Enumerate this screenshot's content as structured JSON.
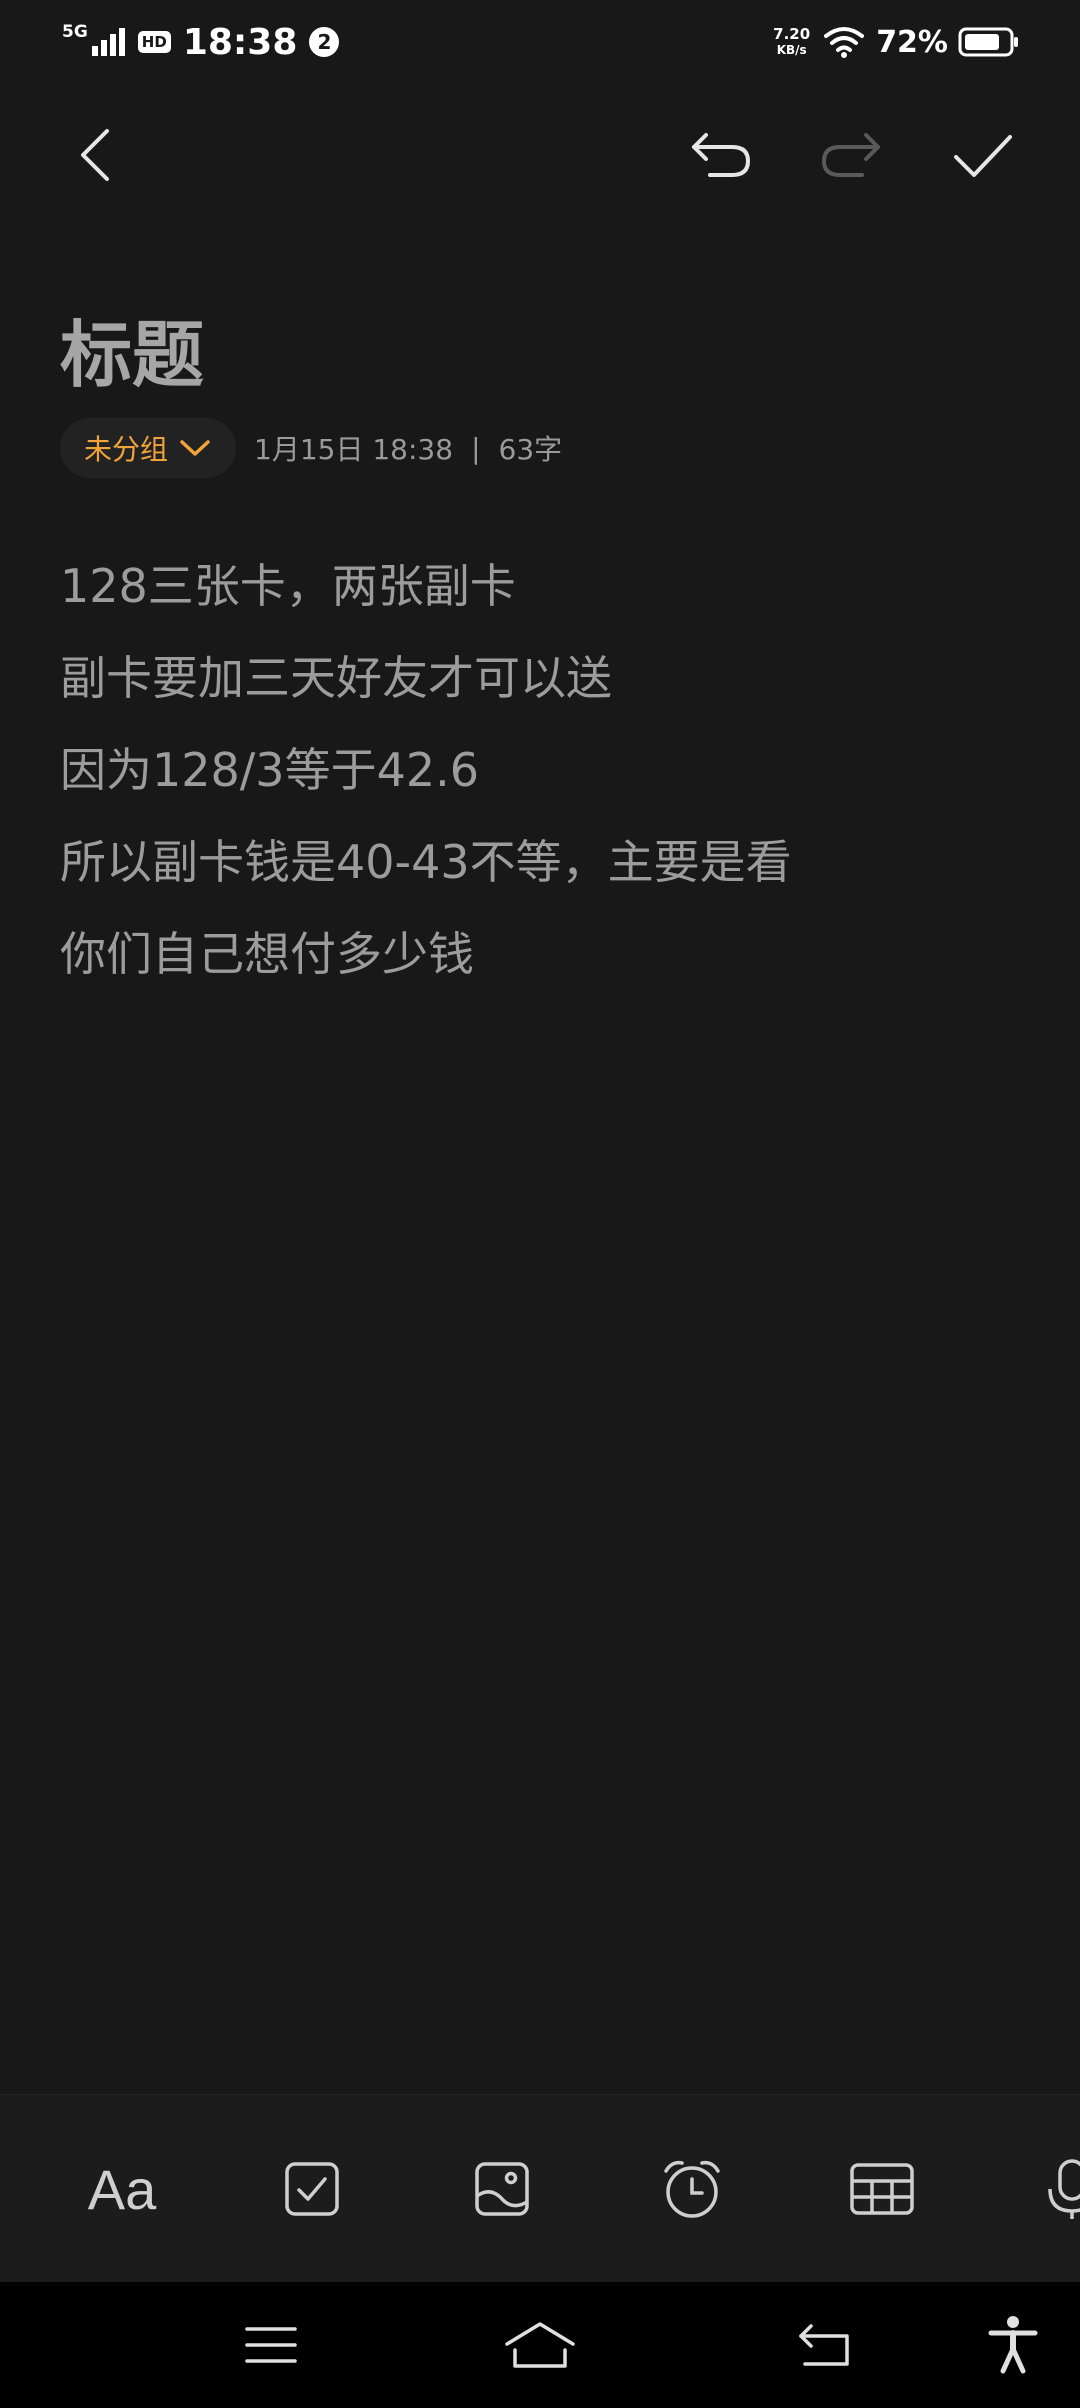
{
  "status_bar": {
    "network": "5G",
    "hd": "HD",
    "time": "18:38",
    "notification_count": "2",
    "speed_value": "7.20",
    "speed_unit": "KB/s",
    "battery": "72%"
  },
  "note": {
    "title": "标题",
    "group_label": "未分组",
    "datetime": "1月15日 18:38",
    "separator": "|",
    "word_count": "63字",
    "lines": [
      "128三张卡，两张副卡",
      "副卡要加三天好友才可以送",
      "因为128/3等于42.6",
      "所以副卡钱是40-43不等，主要是看",
      "你们自己想付多少钱"
    ]
  },
  "toolbar": {
    "back_icon": "chevron-left-icon",
    "undo_icon": "undo-icon",
    "redo_icon": "redo-icon",
    "done_icon": "check-icon"
  },
  "format_bar": {
    "text_style_label": "Aa",
    "items": [
      "text-style",
      "checklist",
      "image",
      "alarm",
      "table",
      "microphone"
    ]
  },
  "colors": {
    "background": "#181818",
    "accent": "#f0a43a",
    "text": "#9c9c9c"
  }
}
